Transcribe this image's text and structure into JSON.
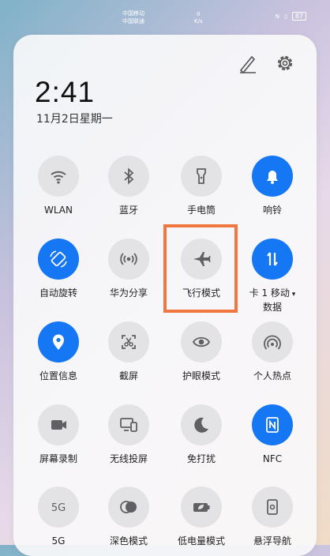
{
  "status_bar": {
    "carrier_1": "中国移动",
    "carrier_2": "中国联通",
    "speed_value": "0",
    "speed_unit": "K/s",
    "battery": "87"
  },
  "panel": {
    "time": "2:41",
    "date": "11月2日星期一"
  },
  "tiles": [
    {
      "label": "WLAN",
      "icon": "wifi-icon",
      "on": false
    },
    {
      "label": "蓝牙",
      "icon": "bluetooth-icon",
      "on": false
    },
    {
      "label": "手电筒",
      "icon": "flashlight-icon",
      "on": false
    },
    {
      "label": "响铃",
      "icon": "bell-icon",
      "on": true
    },
    {
      "label": "自动旋转",
      "icon": "rotate-icon",
      "on": true
    },
    {
      "label": "华为分享",
      "icon": "share-icon",
      "on": false
    },
    {
      "label": "飞行模式",
      "icon": "airplane-icon",
      "on": false
    },
    {
      "label": "卡 1 移动",
      "label_2": "数据",
      "icon": "mobile-data-icon",
      "on": true
    },
    {
      "label": "位置信息",
      "icon": "location-icon",
      "on": true
    },
    {
      "label": "截屏",
      "icon": "screenshot-icon",
      "on": false
    },
    {
      "label": "护眼模式",
      "icon": "eye-icon",
      "on": false
    },
    {
      "label": "个人热点",
      "icon": "hotspot-icon",
      "on": false
    },
    {
      "label": "屏幕录制",
      "icon": "record-icon",
      "on": false
    },
    {
      "label": "无线投屏",
      "icon": "cast-icon",
      "on": false
    },
    {
      "label": "免打扰",
      "icon": "moon-icon",
      "on": false
    },
    {
      "label": "NFC",
      "icon": "nfc-icon",
      "on": true
    },
    {
      "label": "5G",
      "icon": "5g-icon",
      "on": false
    },
    {
      "label": "深色模式",
      "icon": "dark-mode-icon",
      "on": false
    },
    {
      "label": "低电量模式",
      "icon": "battery-saver-icon",
      "on": false
    },
    {
      "label": "悬浮导航",
      "icon": "float-nav-icon",
      "on": false
    }
  ],
  "colors": {
    "accent": "#1677f5",
    "highlight_border": "#f0773f",
    "tile_off": "#e3e3e6"
  },
  "highlighted_tile": "飞行模式"
}
